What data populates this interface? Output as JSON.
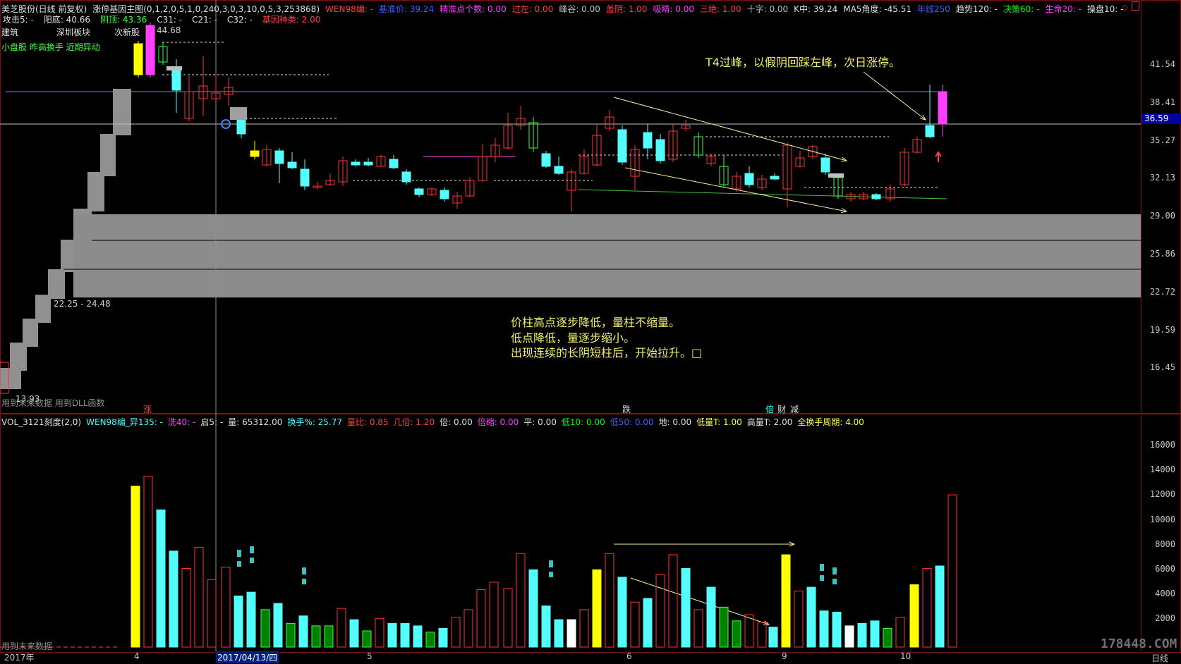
{
  "header": {
    "line1": [
      {
        "text": "美芝股份(日线 前复权)",
        "color": "#e0e0e0"
      },
      {
        "text": "涨停基因主图(0,1,2,0,5,1,0,240,3,0,3,10,0,5,3,253868)",
        "color": "#e0e0e0"
      },
      {
        "text": "WEN98编: -",
        "color": "#ff4040"
      },
      {
        "text": "基准价: 39.24",
        "color": "#4060ff"
      },
      {
        "text": "精准点个数: 0.00",
        "color": "#ff40ff"
      },
      {
        "text": "过左: 0.00",
        "color": "#ff4040"
      },
      {
        "text": "峰谷: 0.00",
        "color": "#c0c0c0"
      },
      {
        "text": "盖阴: 1.00",
        "color": "#ff4040"
      },
      {
        "text": "吸睛: 0.00",
        "color": "#ff40ff"
      },
      {
        "text": "三绝: 1.00",
        "color": "#ff4040"
      },
      {
        "text": "十字: 0.00",
        "color": "#c0c0c0"
      },
      {
        "text": "K中: 39.24",
        "color": "#e0e0e0"
      },
      {
        "text": "MA5角度: -45.51",
        "color": "#e0e0e0"
      },
      {
        "text": "年线250",
        "color": "#4060ff"
      },
      {
        "text": "趋势120: -",
        "color": "#e0e0e0"
      },
      {
        "text": "决策60: -",
        "color": "#00ff00"
      },
      {
        "text": "生命20: -",
        "color": "#ff40ff"
      },
      {
        "text": "操盘10: -",
        "color": "#e0e0e0"
      }
    ],
    "line2": [
      {
        "text": "攻击5: -",
        "color": "#e0e0e0"
      },
      {
        "text": "阳底: 40.66",
        "color": "#e0e0e0"
      },
      {
        "text": "阴顶: 43.36",
        "color": "#40ff40"
      },
      {
        "text": "C31: -",
        "color": "#e0e0e0"
      },
      {
        "text": "C21: -",
        "color": "#e0e0e0"
      },
      {
        "text": "C32: -",
        "color": "#e0e0e0"
      },
      {
        "text": "基因种类: 2.00",
        "color": "#ff4040"
      }
    ],
    "sectors": [
      "建筑",
      "深圳板块",
      "次新股"
    ],
    "tags": "小盘股 昨高换手 近期异动",
    "peak_label": "44.68",
    "range_label": "22.25 - 24.48",
    "low_label": "13.93",
    "bottom_note": "用到未来数据 用到DLL函数"
  },
  "price_axis": [
    "41.54",
    "38.41",
    "35.27",
    "32.13",
    "29.00",
    "25.86",
    "22.72",
    "19.59",
    "16.45"
  ],
  "current_price": "36.59",
  "annotations": {
    "t4": "T4过峰，以假阴回踩左峰，次日涨停。",
    "lines": [
      "价柱高点逐步降低，量柱不缩量。",
      "低点降低，量逐步缩小。",
      "出现连续的长阴短柱后，开始拉升。□"
    ]
  },
  "markers": {
    "zhang": "涨",
    "die": "跌",
    "bei": "倍",
    "cai": "财",
    "jian": "减"
  },
  "volume_header": [
    {
      "text": "VOL_3121刻度(2,0)",
      "color": "#e0e0e0"
    },
    {
      "text": "WEN98编_异135: -",
      "color": "#40ffff"
    },
    {
      "text": "洗40: -",
      "color": "#ff40ff"
    },
    {
      "text": "启5: -",
      "color": "#e0e0e0"
    },
    {
      "text": "量: 65312.00",
      "color": "#e0e0e0"
    },
    {
      "text": "换手%: 25.77",
      "color": "#40ffff"
    },
    {
      "text": "量比: 0.85",
      "color": "#ff4040"
    },
    {
      "text": "几倍: 1.20",
      "color": "#ff4040"
    },
    {
      "text": "倍: 0.00",
      "color": "#e0e0e0"
    },
    {
      "text": "倍缩: 0.00",
      "color": "#ff40ff"
    },
    {
      "text": "平: 0.00",
      "color": "#e0e0e0"
    },
    {
      "text": "低10: 0.00",
      "color": "#00ff00"
    },
    {
      "text": "低50: 0.00",
      "color": "#4060ff"
    },
    {
      "text": "地: 0.00",
      "color": "#e0e0e0"
    },
    {
      "text": "低量T: 1.00",
      "color": "#ffff40"
    },
    {
      "text": "高量T: 2.00",
      "color": "#e0e0e0"
    },
    {
      "text": "全换手周期: 4.00",
      "color": "#ffff40"
    }
  ],
  "volume_axis": [
    "16000",
    "14000",
    "12000",
    "10000",
    "8000",
    "6000",
    "4000",
    "2000"
  ],
  "volume_note": "用到未来数据",
  "date_axis": [
    {
      "text": "2017年"
    },
    {
      "text": "4"
    },
    {
      "text": "2017/04/13/四"
    },
    {
      "text": "5"
    },
    {
      "text": "6"
    },
    {
      "text": "9"
    },
    {
      "text": "10"
    }
  ],
  "period_label": "日线",
  "watermark": "178448.COM",
  "colors": {
    "up": "#ff3232",
    "down": "#54fcfc",
    "yellow": "#ffff00",
    "white": "#ffffff",
    "grey": "#909090",
    "green": "#00c000"
  }
}
